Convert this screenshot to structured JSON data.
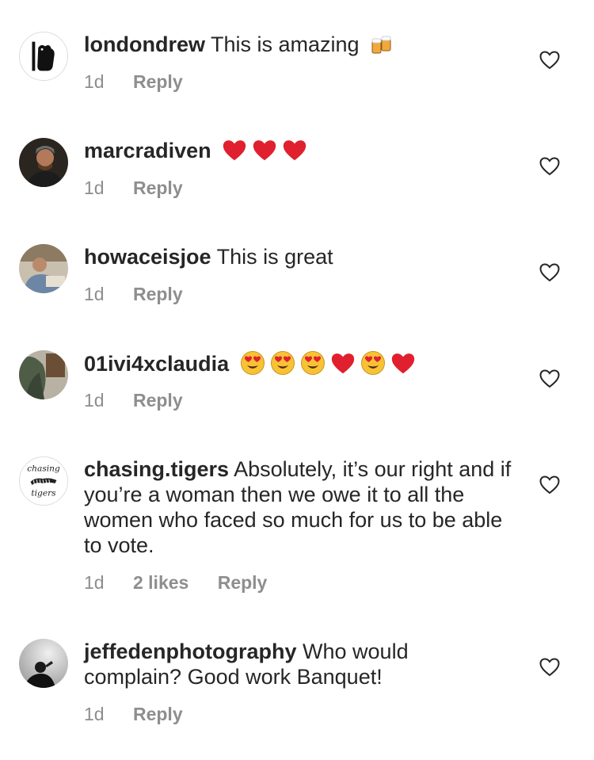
{
  "comments": [
    {
      "username": "londondrew",
      "text": "This is amazing",
      "emojis": [
        "beer-mugs-emoji"
      ],
      "time": "1d",
      "likes": "",
      "reply_label": "Reply"
    },
    {
      "username": "marcradiven",
      "text": "",
      "emojis": [
        "red-heart-emoji",
        "red-heart-emoji",
        "red-heart-emoji"
      ],
      "time": "1d",
      "likes": "",
      "reply_label": "Reply"
    },
    {
      "username": "howaceisjoe",
      "text": "This is great",
      "emojis": [],
      "time": "1d",
      "likes": "",
      "reply_label": "Reply"
    },
    {
      "username": "01ivi4xclaudia",
      "text": "",
      "emojis": [
        "heart-eyes-emoji",
        "heart-eyes-emoji",
        "heart-eyes-emoji",
        "red-heart-emoji",
        "heart-eyes-emoji",
        "red-heart-emoji"
      ],
      "time": "1d",
      "likes": "",
      "reply_label": "Reply"
    },
    {
      "username": "chasing.tigers",
      "text": "Absolutely, it’s our right and if you’re a woman then we owe it to all the women who faced so much for us to be able to vote.",
      "emojis": [],
      "time": "1d",
      "likes": "2 likes",
      "reply_label": "Reply"
    },
    {
      "username": "jeffedenphotography",
      "text": "Who would complain? Good work Banquet!",
      "emojis": [],
      "time": "1d",
      "likes": "",
      "reply_label": "Reply"
    }
  ],
  "avatars": {
    "chasing_tigers_logo_text": [
      "chasing",
      "tigers"
    ]
  },
  "colors": {
    "text": "#262626",
    "meta": "#8e8e8e",
    "heart_red": "#e0202e",
    "emoji_yellow": "#f7c335"
  }
}
